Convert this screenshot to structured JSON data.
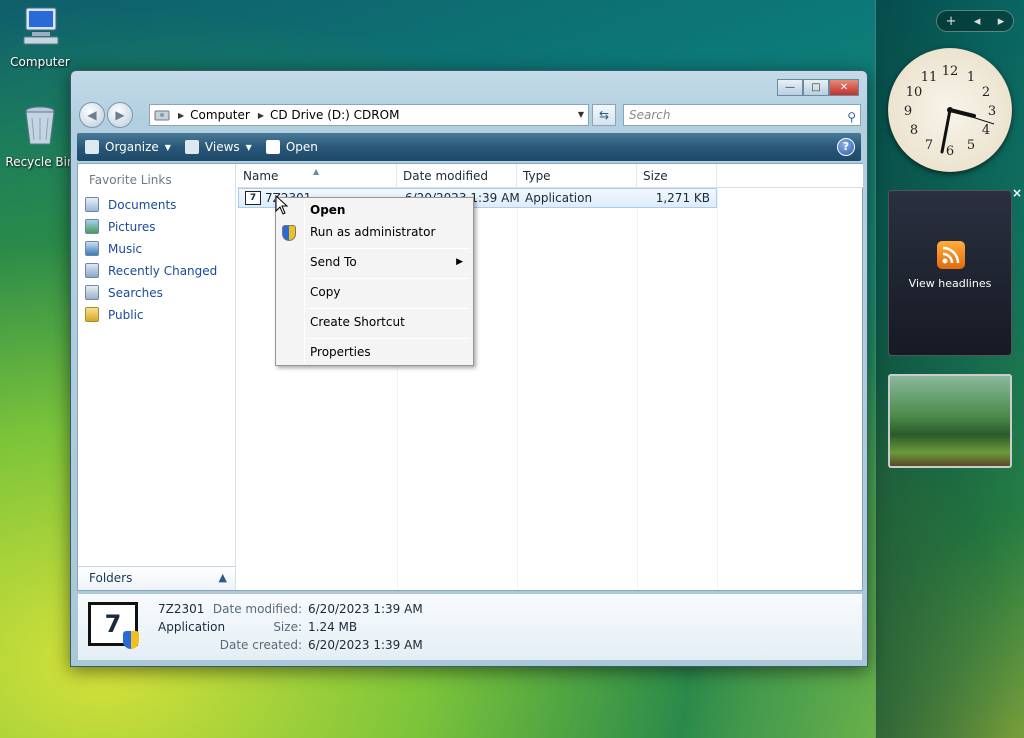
{
  "desktop": {
    "icons": [
      {
        "label": "Computer"
      },
      {
        "label": "Recycle Bin"
      }
    ]
  },
  "sidebar": {
    "top_controls": [
      "+",
      "◂",
      "▸"
    ],
    "clock_numerals": [
      "12",
      "1",
      "2",
      "3",
      "4",
      "5",
      "6",
      "7",
      "8",
      "9",
      "10",
      "11"
    ],
    "feed_label": "View headlines",
    "close_glyph": "×"
  },
  "window": {
    "controls": {
      "minimize": "—",
      "maximize": "□",
      "close": "✕"
    },
    "address": {
      "segments": [
        "Computer",
        "CD Drive (D:) CDROM"
      ]
    },
    "search": {
      "placeholder": "Search"
    },
    "toolbar": {
      "organize": "Organize",
      "views": "Views",
      "open": "Open",
      "help": "?"
    },
    "favorites": {
      "title": "Favorite Links",
      "items": [
        "Documents",
        "Pictures",
        "Music",
        "Recently Changed",
        "Searches",
        "Public"
      ]
    },
    "folders_label": "Folders",
    "columns": [
      "Name",
      "Date modified",
      "Type",
      "Size"
    ],
    "file": {
      "name": "7Z2301",
      "date_modified": "6/20/2023 1:39 AM",
      "type": "Application",
      "size": "1,271 KB"
    },
    "details": {
      "name": "7Z2301",
      "type": "Application",
      "date_modified_label": "Date modified:",
      "date_modified": "6/20/2023 1:39 AM",
      "size_label": "Size:",
      "size": "1.24 MB",
      "date_created_label": "Date created:",
      "date_created": "6/20/2023 1:39 AM",
      "icon_text": "7"
    }
  },
  "context_menu": {
    "items": [
      "Open",
      "Run as administrator",
      "Send To",
      "Copy",
      "Create Shortcut",
      "Properties"
    ]
  },
  "colors": {
    "link": "#1a4a9a",
    "toolbar": "#2a5878",
    "selection": "#ddecfb"
  }
}
